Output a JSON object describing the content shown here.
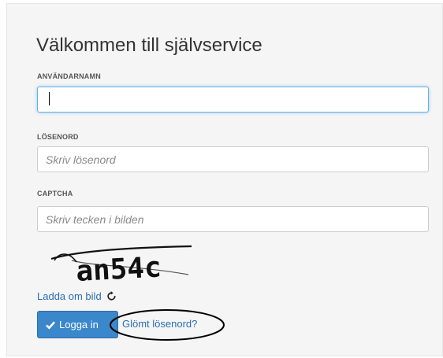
{
  "form": {
    "title": "Välkommen till självservice",
    "username": {
      "label": "ANVÄNDARNAMN",
      "value": "",
      "placeholder": ""
    },
    "password": {
      "label": "LÖSENORD",
      "value": "",
      "placeholder": "Skriv lösenord"
    },
    "captcha": {
      "label": "CAPTCHA",
      "value": "",
      "placeholder": "Skriv tecken i bilden",
      "image_text": "an54c"
    },
    "reload_label": "Ladda om bild",
    "login_label": "Logga in",
    "forgot_label": "Glömt lösenord?"
  },
  "colors": {
    "accent": "#3a87cb",
    "link": "#2a6eb5",
    "focus": "#66afe9",
    "panel": "#f5f5f5"
  },
  "icons": {
    "login": "check-icon",
    "reload": "reload-icon"
  }
}
